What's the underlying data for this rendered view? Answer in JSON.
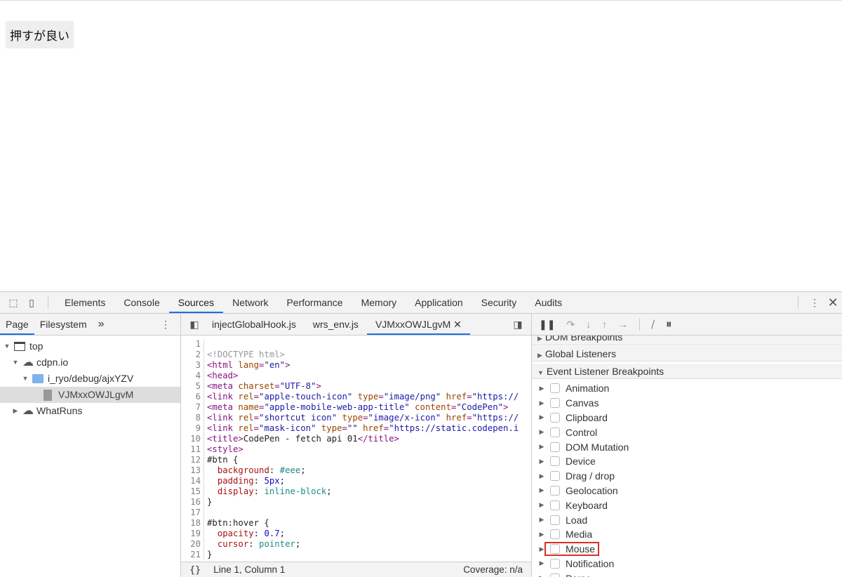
{
  "page": {
    "button_label": "押すが良い"
  },
  "devtools": {
    "tabs": [
      "Elements",
      "Console",
      "Sources",
      "Network",
      "Performance",
      "Memory",
      "Application",
      "Security",
      "Audits"
    ],
    "active_tab": "Sources",
    "navigator": {
      "tabs": [
        "Page",
        "Filesystem"
      ],
      "more": "»",
      "tree": [
        {
          "label": "top",
          "icon": "frame-icon",
          "expanded": true
        },
        {
          "label": "cdpn.io",
          "icon": "cloud-icon",
          "expanded": true
        },
        {
          "label": "i_ryo/debug/ajxYZV",
          "icon": "folder-icon",
          "expanded": true
        },
        {
          "label": "VJMxxOWJLgvM",
          "icon": "file-icon",
          "selected": true
        },
        {
          "label": "WhatRuns",
          "icon": "cloud-icon",
          "expanded": false
        }
      ]
    },
    "editor": {
      "tabs": [
        "injectGlobalHook.js",
        "wrs_env.js",
        "VJMxxOWJLgvM"
      ],
      "active_tab": "VJMxxOWJLgvM",
      "lines": [
        [],
        [
          [
            "cm",
            "<!DOCTYPE html>"
          ]
        ],
        [
          [
            "tag",
            "<html "
          ],
          [
            "attr",
            "lang"
          ],
          [
            "tag",
            "="
          ],
          [
            "val",
            "\"en\""
          ],
          [
            "tag",
            ">"
          ]
        ],
        [
          [
            "tag",
            "<head>"
          ]
        ],
        [
          [
            "tag",
            "<meta "
          ],
          [
            "attr",
            "charset"
          ],
          [
            "tag",
            "="
          ],
          [
            "val",
            "\"UTF-8\""
          ],
          [
            "tag",
            ">"
          ]
        ],
        [
          [
            "tag",
            "<link "
          ],
          [
            "attr",
            "rel"
          ],
          [
            "tag",
            "="
          ],
          [
            "val",
            "\"apple-touch-icon\" "
          ],
          [
            "attr",
            "type"
          ],
          [
            "tag",
            "="
          ],
          [
            "val",
            "\"image/png\" "
          ],
          [
            "attr",
            "href"
          ],
          [
            "tag",
            "="
          ],
          [
            "val",
            "\"https://"
          ]
        ],
        [
          [
            "tag",
            "<meta "
          ],
          [
            "attr",
            "name"
          ],
          [
            "tag",
            "="
          ],
          [
            "val",
            "\"apple-mobile-web-app-title\" "
          ],
          [
            "attr",
            "content"
          ],
          [
            "tag",
            "="
          ],
          [
            "val",
            "\"CodePen\""
          ],
          [
            "tag",
            ">"
          ]
        ],
        [
          [
            "tag",
            "<link "
          ],
          [
            "attr",
            "rel"
          ],
          [
            "tag",
            "="
          ],
          [
            "val",
            "\"shortcut icon\" "
          ],
          [
            "attr",
            "type"
          ],
          [
            "tag",
            "="
          ],
          [
            "val",
            "\"image/x-icon\" "
          ],
          [
            "attr",
            "href"
          ],
          [
            "tag",
            "="
          ],
          [
            "val",
            "\"https://"
          ]
        ],
        [
          [
            "tag",
            "<link "
          ],
          [
            "attr",
            "rel"
          ],
          [
            "tag",
            "="
          ],
          [
            "val",
            "\"mask-icon\" "
          ],
          [
            "attr",
            "type"
          ],
          [
            "tag",
            "="
          ],
          [
            "val",
            "\"\" "
          ],
          [
            "attr",
            "href"
          ],
          [
            "tag",
            "="
          ],
          [
            "val",
            "\"https://static.codepen.i"
          ]
        ],
        [
          [
            "tag",
            "<title>"
          ],
          [
            "txt",
            "CodePen - fetch api 01"
          ],
          [
            "tag",
            "</title>"
          ]
        ],
        [
          [
            "tag",
            "<style>"
          ]
        ],
        [
          [
            "txt",
            "#btn {"
          ]
        ],
        [
          [
            "txt",
            "  "
          ],
          [
            "prop",
            "background"
          ],
          [
            "txt",
            ": "
          ],
          [
            "kw",
            "#eee"
          ],
          [
            "txt",
            ";"
          ]
        ],
        [
          [
            "txt",
            "  "
          ],
          [
            "prop",
            "padding"
          ],
          [
            "txt",
            ": "
          ],
          [
            "num",
            "5px"
          ],
          [
            "txt",
            ";"
          ]
        ],
        [
          [
            "txt",
            "  "
          ],
          [
            "prop",
            "display"
          ],
          [
            "txt",
            ": "
          ],
          [
            "kw",
            "inline-block"
          ],
          [
            "txt",
            ";"
          ]
        ],
        [
          [
            "txt",
            "}"
          ]
        ],
        [],
        [
          [
            "txt",
            "#btn:hover {"
          ]
        ],
        [
          [
            "txt",
            "  "
          ],
          [
            "prop",
            "opacity"
          ],
          [
            "txt",
            ": "
          ],
          [
            "num",
            "0.7"
          ],
          [
            "txt",
            ";"
          ]
        ],
        [
          [
            "txt",
            "  "
          ],
          [
            "prop",
            "cursor"
          ],
          [
            "txt",
            ": "
          ],
          [
            "kw",
            "pointer"
          ],
          [
            "txt",
            ";"
          ]
        ],
        [
          [
            "txt",
            "}"
          ]
        ]
      ],
      "status": {
        "format": "{}",
        "position": "Line 1, Column 1",
        "coverage": "Coverage: n/a"
      }
    },
    "debugger": {
      "sections": [
        "DOM Breakpoints",
        "Global Listeners",
        "Event Listener Breakpoints"
      ],
      "event_categories": [
        "Animation",
        "Canvas",
        "Clipboard",
        "Control",
        "DOM Mutation",
        "Device",
        "Drag / drop",
        "Geolocation",
        "Keyboard",
        "Load",
        "Media",
        "Mouse",
        "Notification",
        "Parse"
      ],
      "highlighted": "Mouse",
      "highlight_color": "#d93025"
    }
  }
}
